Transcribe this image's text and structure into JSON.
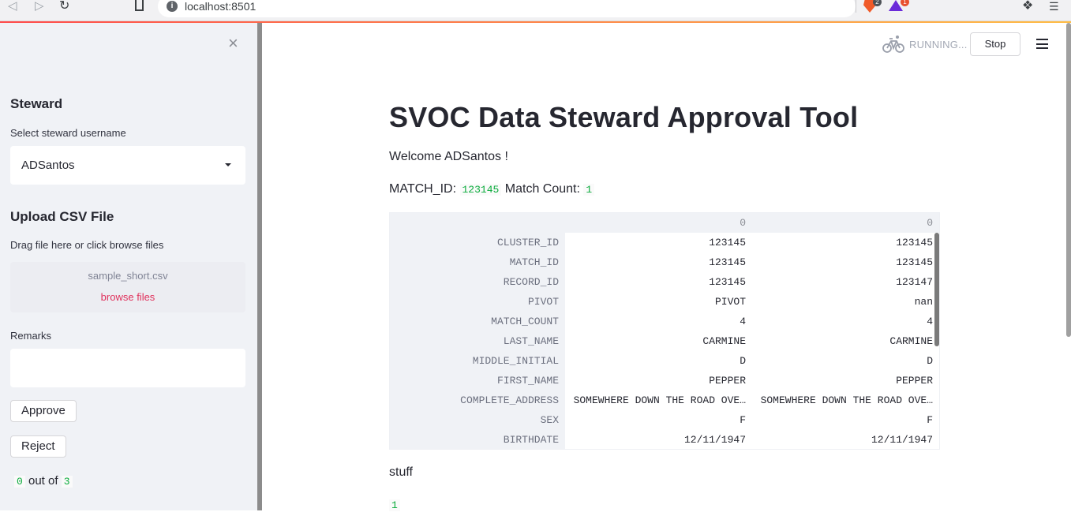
{
  "browser": {
    "url": "localhost:8501",
    "back_icon": "arrow-left",
    "forward_icon": "arrow-right",
    "reload_icon": "reload",
    "ext_badges": [
      "2",
      "1"
    ]
  },
  "status": {
    "running_text": "RUNNING...",
    "stop_label": "Stop"
  },
  "sidebar": {
    "close_glyph": "×",
    "steward_heading": "Steward",
    "select_label": "Select steward username",
    "selected_user": "ADSantos",
    "upload_heading": "Upload CSV File",
    "upload_hint": "Drag file here or click browse files",
    "uploaded_file": "sample_short.csv",
    "browse_label": "browse files",
    "remarks_label": "Remarks",
    "remarks_value": "",
    "approve_label": "Approve",
    "reject_label": "Reject",
    "progress": {
      "current": "0",
      "middle": "out of",
      "total": "3"
    }
  },
  "main": {
    "title": "SVOC Data Steward Approval Tool",
    "welcome": "Welcome ADSantos !",
    "match_id_label": "MATCH_ID:",
    "match_id_value": "123145",
    "match_count_label": "Match Count:",
    "match_count_value": "1",
    "stuff_text": "stuff",
    "bottom_value": "1"
  },
  "table": {
    "columns": [
      "0",
      "0"
    ],
    "rows": [
      {
        "index": "CLUSTER_ID",
        "values": [
          "123145",
          "123145"
        ]
      },
      {
        "index": "MATCH_ID",
        "values": [
          "123145",
          "123145"
        ]
      },
      {
        "index": "RECORD_ID",
        "values": [
          "123145",
          "123147"
        ]
      },
      {
        "index": "PIVOT",
        "values": [
          "PIVOT",
          "nan"
        ]
      },
      {
        "index": "MATCH_COUNT",
        "values": [
          "4",
          "4"
        ]
      },
      {
        "index": "LAST_NAME",
        "values": [
          "CARMINE",
          "CARMINE"
        ]
      },
      {
        "index": "MIDDLE_INITIAL",
        "values": [
          "D",
          "D"
        ]
      },
      {
        "index": "FIRST_NAME",
        "values": [
          "PEPPER",
          "PEPPER"
        ]
      },
      {
        "index": "COMPLETE_ADDRESS",
        "values": [
          "SOMEWHERE DOWN THE ROAD OVE…",
          "SOMEWHERE DOWN THE ROAD OVE…"
        ]
      },
      {
        "index": "SEX",
        "values": [
          "F",
          "F"
        ]
      },
      {
        "index": "BIRTHDATE",
        "values": [
          "12/11/1947",
          "12/11/1947"
        ]
      }
    ]
  }
}
